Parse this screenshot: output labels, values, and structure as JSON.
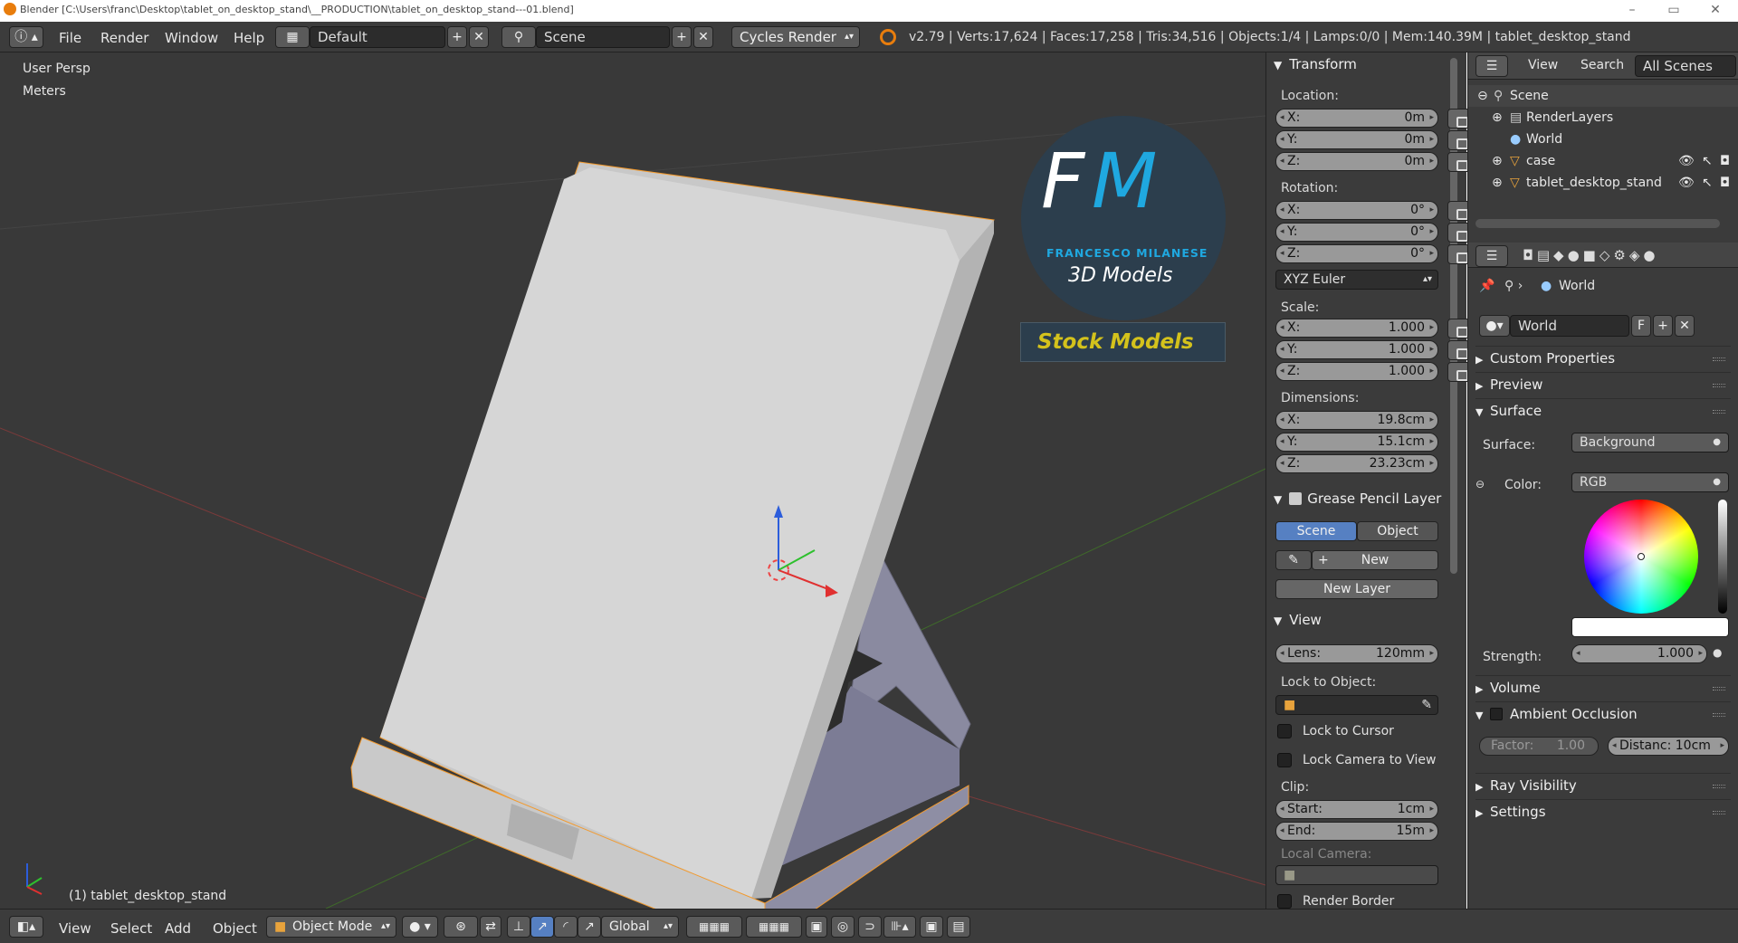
{
  "window": {
    "title": "Blender [C:\\Users\\franc\\Desktop\\tablet_on_desktop_stand\\__PRODUCTION\\tablet_on_desktop_stand---01.blend]",
    "minimize": "–",
    "maximize": "▭",
    "close": "✕"
  },
  "menu": {
    "file": "File",
    "render": "Render",
    "window": "Window",
    "help": "Help"
  },
  "layout": {
    "value": "Default"
  },
  "scene": {
    "value": "Scene"
  },
  "engine": {
    "value": "Cycles Render"
  },
  "stats": "v2.79 | Verts:17,624 | Faces:17,258 | Tris:34,516 | Objects:1/4 | Lamps:0/0 | Mem:140.39M | tablet_desktop_stand",
  "viewport": {
    "persp": "User Persp",
    "units": "Meters",
    "object_label": "(1) tablet_desktop_stand"
  },
  "logo": {
    "initial_f": "F",
    "initial_m": "M",
    "name": "FRANCESCO MILANESE",
    "sub": "3D Models",
    "stock": "Stock Models"
  },
  "transform": {
    "title": "Transform",
    "location": {
      "label": "Location:",
      "x": "0m",
      "y": "0m",
      "z": "0m"
    },
    "rotation": {
      "label": "Rotation:",
      "x": "0°",
      "y": "0°",
      "z": "0°"
    },
    "rotation_mode": "XYZ Euler",
    "scale": {
      "label": "Scale:",
      "x": "1.000",
      "y": "1.000",
      "z": "1.000"
    },
    "dimensions": {
      "label": "Dimensions:",
      "x": "19.8cm",
      "y": "15.1cm",
      "z": "23.23cm"
    },
    "axis": {
      "x": "X:",
      "y": "Y:",
      "z": "Z:"
    }
  },
  "grease": {
    "title": "Grease Pencil Layer",
    "scene": "Scene",
    "object": "Object",
    "new": "New",
    "new_layer": "New Layer"
  },
  "view": {
    "title": "View",
    "lens_label": "Lens:",
    "lens": "120mm",
    "lock_obj": "Lock to Object:",
    "lock_cursor": "Lock to Cursor",
    "lock_camera": "Lock Camera to View",
    "clip": "Clip:",
    "start_label": "Start:",
    "start": "1cm",
    "end_label": "End:",
    "end": "15m",
    "local_camera": "Local Camera:",
    "render_border": "Render Border"
  },
  "outliner": {
    "view": "View",
    "search": "Search",
    "filter": "All Scenes",
    "rows": [
      "Scene",
      "RenderLayers",
      "World",
      "case",
      "tablet_desktop_stand"
    ]
  },
  "properties": {
    "breadcrumb": "World",
    "world_name": "World",
    "fake": "F",
    "sections": {
      "custom": "Custom Properties",
      "preview": "Preview",
      "surface": "Surface",
      "volume": "Volume",
      "ao": "Ambient Occlusion",
      "ray": "Ray Visibility",
      "settings": "Settings"
    },
    "surface_label": "Surface:",
    "surface_value": "Background",
    "color_label": "Color:",
    "color_value": "RGB",
    "strength_label": "Strength:",
    "strength": "1.000",
    "factor_label": "Factor:",
    "factor": "1.00",
    "distance": "Distanc: 10cm"
  },
  "bottom": {
    "view": "View",
    "select": "Select",
    "add": "Add",
    "object": "Object",
    "mode": "Object Mode",
    "orientation": "Global"
  },
  "colors": {
    "accent": "#5680c2",
    "object_outline": "#f29a2e",
    "logo_blue": "#1fa8e0",
    "stock_yellow": "#d4c21c"
  }
}
